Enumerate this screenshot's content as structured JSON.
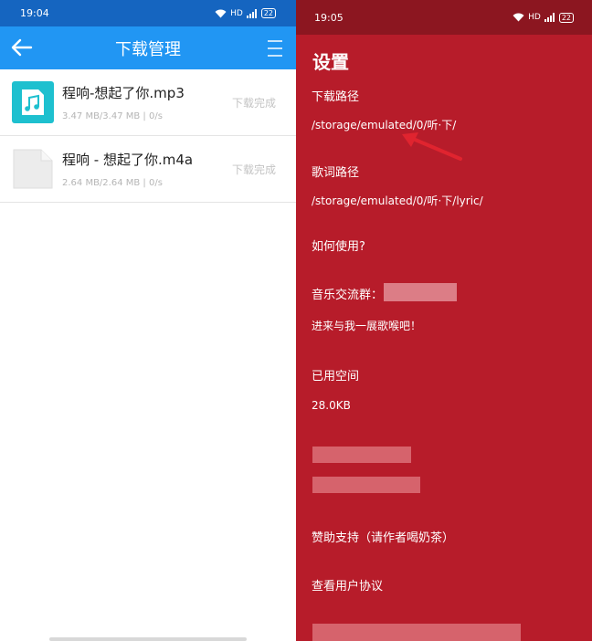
{
  "left": {
    "status": {
      "time": "19:04",
      "hd": "HD",
      "battery": "22"
    },
    "appbar": {
      "title": "下载管理"
    },
    "items": [
      {
        "name": "程响-想起了你.mp3",
        "size": "3.47 MB/3.47 MB | 0/s",
        "status": "下载完成",
        "icon": "music-file-icon"
      },
      {
        "name": "程响 - 想起了你.m4a",
        "size": "2.64 MB/2.64 MB | 0/s",
        "status": "下载完成",
        "icon": "blank-file-icon"
      }
    ]
  },
  "right": {
    "status": {
      "time": "19:05",
      "hd": "HD",
      "battery": "22"
    },
    "title": "设置",
    "download_path_label": "下载路径",
    "download_path_value": "/storage/emulated/0/听·下/",
    "lyric_path_label": "歌词路径",
    "lyric_path_value": "/storage/emulated/0/听·下/lyric/",
    "how_to_use": "如何使用?",
    "music_group_label": "音乐交流群：",
    "music_group_desc": "进来与我一展歌喉吧！",
    "used_space_label": "已用空间",
    "used_space_value": "28.0KB",
    "donate": "赞助支持（请作者喝奶茶）",
    "user_agreement": "查看用户协议"
  },
  "colors": {
    "left_appbar": "#2196f3",
    "left_statusbar": "#1565c0",
    "right_bg": "#b71c2a",
    "right_statusbar": "#8c1620",
    "arrow": "#e0242f"
  }
}
